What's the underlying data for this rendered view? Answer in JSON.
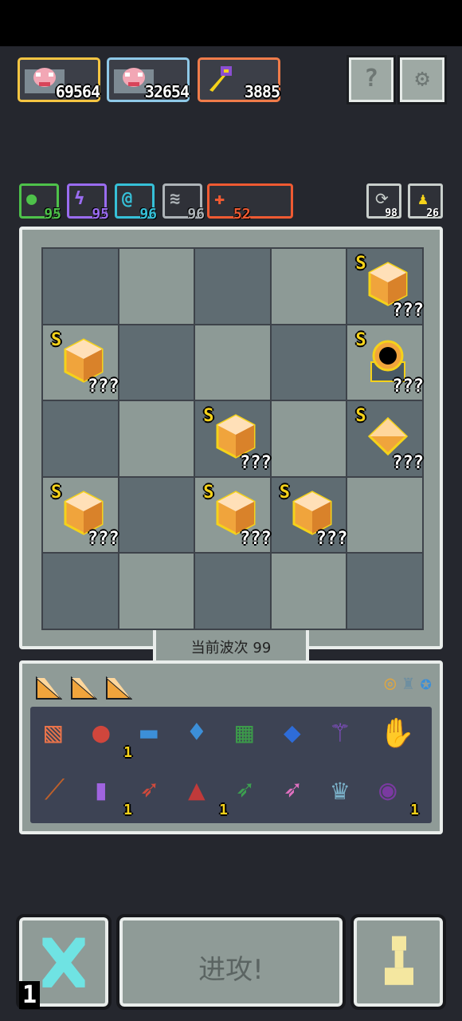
{
  "heroes": [
    {
      "value": "69564",
      "border": "#f5c542"
    },
    {
      "value": "32654",
      "border": "#8fc9e8"
    },
    {
      "value": "3885",
      "border": "#f07c4a"
    }
  ],
  "top_buttons": {
    "help": "?",
    "settings": "⚙"
  },
  "elements": [
    {
      "icon": "nature-orb-icon",
      "color": "#4ec24a",
      "value": "95"
    },
    {
      "icon": "lightning-icon",
      "color": "#9a6cf0",
      "value": "95"
    },
    {
      "icon": "water-swirl-icon",
      "color": "#36c0d8",
      "value": "96"
    },
    {
      "icon": "wind-icon",
      "color": "#aeb4b8",
      "value": "96"
    },
    {
      "icon": "fire-cross-icon",
      "color": "#ef5a32",
      "value": "52"
    }
  ],
  "counters": {
    "refresh": "98",
    "unit": "26"
  },
  "board": {
    "tier_label": "S",
    "unknown_label": "???",
    "cells": [
      [
        0,
        0,
        0,
        0,
        1
      ],
      [
        1,
        0,
        0,
        0,
        2
      ],
      [
        0,
        0,
        1,
        0,
        3
      ],
      [
        1,
        0,
        1,
        1,
        0
      ],
      [
        0,
        0,
        0,
        0,
        0
      ]
    ]
  },
  "wave": {
    "label": "当前波次 99"
  },
  "inventory": {
    "shards": 3,
    "rows": [
      [
        {
          "icon": "scroll-icon",
          "badge": ""
        },
        {
          "icon": "eye-potion-icon",
          "badge": "1"
        },
        {
          "icon": "goggles-icon",
          "badge": ""
        },
        {
          "icon": "water-drop-icon",
          "badge": ""
        },
        {
          "icon": "vine-tile-icon",
          "badge": ""
        },
        {
          "icon": "blue-drop-tile-icon",
          "badge": ""
        },
        {
          "icon": "magic-staff-icon",
          "badge": ""
        },
        {
          "icon": "eye-hand-icon",
          "badge": ""
        }
      ],
      [
        {
          "icon": "feather-icon",
          "badge": ""
        },
        {
          "icon": "jar-icon",
          "badge": "1"
        },
        {
          "icon": "red-arrow-icon",
          "badge": ""
        },
        {
          "icon": "demon-mask-icon",
          "badge": "1"
        },
        {
          "icon": "green-arrow-icon",
          "badge": ""
        },
        {
          "icon": "pink-arrow-icon",
          "badge": ""
        },
        {
          "icon": "crown-tile-icon",
          "badge": ""
        },
        {
          "icon": "dark-orb-icon",
          "badge": "1"
        }
      ]
    ]
  },
  "actions": {
    "attack_label": "进攻!",
    "speed_label": "1"
  }
}
